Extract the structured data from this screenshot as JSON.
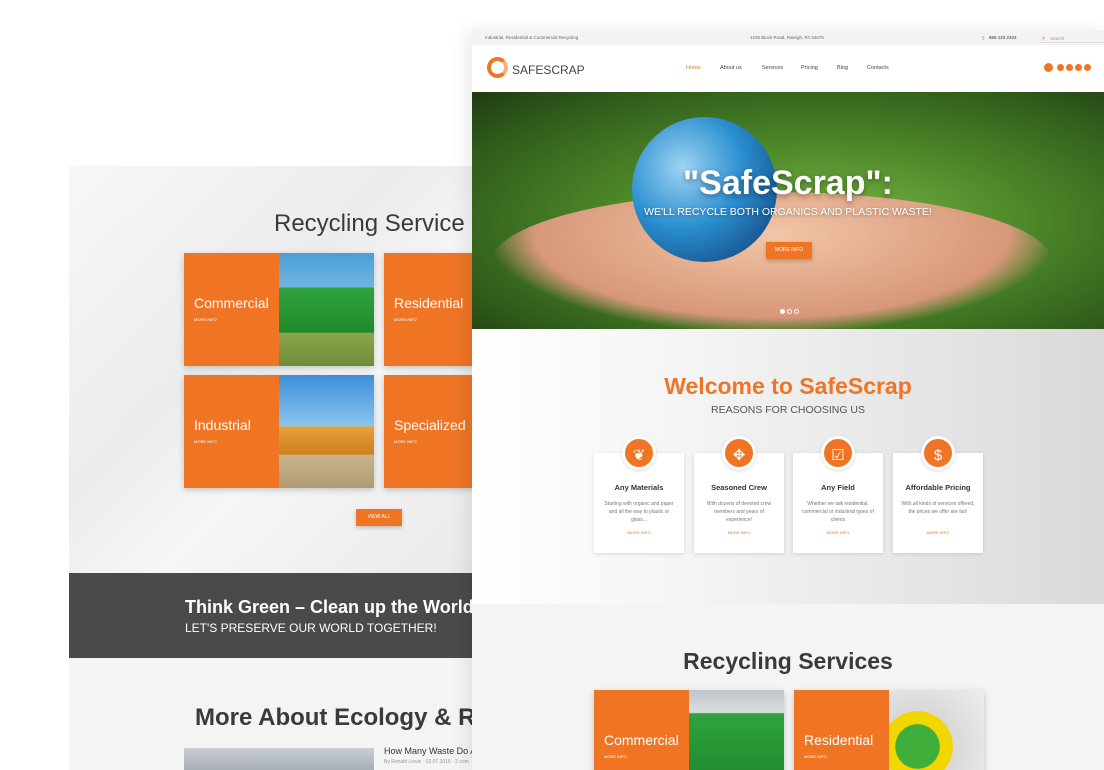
{
  "back": {
    "services_title": "Recycling Service",
    "tiles": [
      {
        "label": "Commercial",
        "more": "MORE INFO"
      },
      {
        "label": "Residential",
        "more": "MORE INFO"
      },
      {
        "label": "Industrial",
        "more": "MORE INFO"
      },
      {
        "label": "Specialized",
        "more": "MORE INFO"
      }
    ],
    "view_all": "VIEW ALL",
    "band_title": "Think Green – Clean up the World",
    "band_sub": "LET'S PRESERVE OUR WORLD TOGETHER!",
    "more_title": "More About Ecology & Re",
    "blog_title": "How Many Waste Do A",
    "blog_meta": "By Ronald Lewis  ·  02.07.2016  ·  2 com"
  },
  "topbar": {
    "tagline": "Industrial, Residential & Commercial Recycling",
    "address": "1235 Block Road, Raleigh, PA 34679",
    "phone": "555 123 2323",
    "search_placeholder": "Search"
  },
  "header": {
    "logo": "SAFESCRAP",
    "nav": [
      "Home",
      "About us",
      "Services",
      "Pricing",
      "Blog",
      "Contacts"
    ],
    "social_icons": [
      "twitter-icon",
      "facebook-icon",
      "dribbble-icon",
      "instagram-icon",
      "youtube-icon"
    ]
  },
  "hero": {
    "title": "\"SafeScrap\":",
    "subtitle": "WE'LL RECYCLE BOTH ORGANICS AND PLASTIC WASTE!",
    "button": "MORE INFO"
  },
  "welcome": {
    "title": "Welcome to SafeScrap",
    "subtitle": "REASONS FOR CHOOSING US",
    "cards": [
      {
        "icon": "leaf-icon",
        "glyph": "❦",
        "title": "Any Materials",
        "desc": "Starting with organic and paper and all the way to plastic or glass...",
        "more": "MORE INFO"
      },
      {
        "icon": "team-icon",
        "glyph": "✥",
        "title": "Seasoned Crew",
        "desc": "With dozens of devoted crew members and years of experience!",
        "more": "MORE INFO"
      },
      {
        "icon": "checkbox-icon",
        "glyph": "☑",
        "title": "Any Field",
        "desc": "Whether we talk residential, commercial or industrial types of clients",
        "more": "MORE INFO"
      },
      {
        "icon": "dollar-icon",
        "glyph": "$",
        "title": "Affordable Pricing",
        "desc": "With all kinds of services offered, the prices we offer are fair!",
        "more": "MORE INFO"
      }
    ]
  },
  "recycling": {
    "title": "Recycling Services",
    "tiles": [
      {
        "label": "Commercial",
        "more": "MORE INFO"
      },
      {
        "label": "Residential",
        "more": "MORE INFO"
      }
    ]
  },
  "colors": {
    "accent": "#ef7525",
    "dark": "#4a4a4a"
  }
}
